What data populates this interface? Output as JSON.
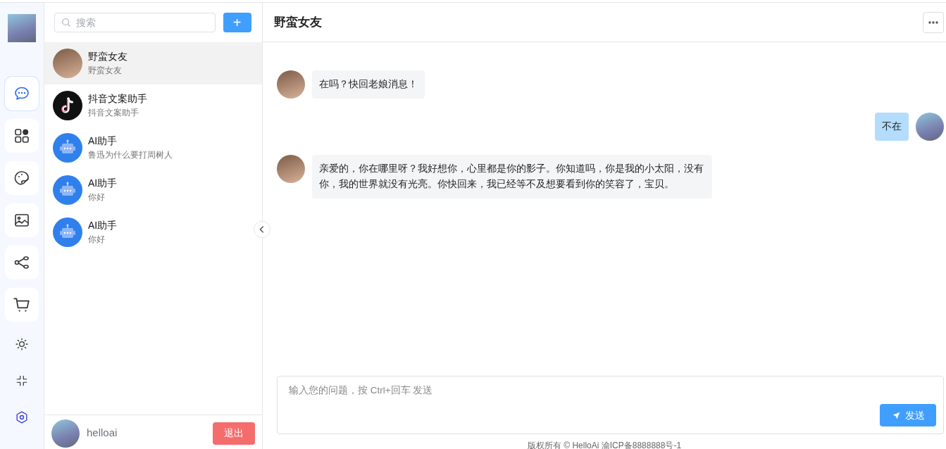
{
  "rail": {
    "items": [
      {
        "kind": "chat",
        "selected": true
      },
      {
        "kind": "apps",
        "selected": false
      },
      {
        "kind": "palette",
        "selected": false
      },
      {
        "kind": "image",
        "selected": false
      },
      {
        "kind": "share",
        "selected": false
      },
      {
        "kind": "cart",
        "selected": false
      }
    ],
    "tools": [
      {
        "kind": "sun"
      },
      {
        "kind": "shrink"
      },
      {
        "kind": "settings"
      }
    ]
  },
  "conversations": {
    "search": {
      "placeholder": "搜索"
    },
    "add_button": "+",
    "items": [
      {
        "name": "野蛮女友",
        "preview": "野蛮女友",
        "kind": "photo",
        "selected": true
      },
      {
        "name": "抖音文案助手",
        "preview": "抖音文案助手",
        "kind": "tiktok",
        "selected": false
      },
      {
        "name": "AI助手",
        "preview": "鲁迅为什么要打周树人",
        "kind": "robot",
        "selected": false
      },
      {
        "name": "AI助手",
        "preview": "你好",
        "kind": "robot",
        "selected": false
      },
      {
        "name": "AI助手",
        "preview": "你好",
        "kind": "robot",
        "selected": false
      }
    ]
  },
  "user": {
    "name": "helloai",
    "logout": "退出"
  },
  "chat": {
    "title": "野蛮女友",
    "messages": [
      {
        "kind": "bot",
        "text": "在吗？快回老娘消息！"
      },
      {
        "kind": "me",
        "text": "不在"
      },
      {
        "kind": "bot",
        "text": "亲爱的，你在哪里呀？我好想你，心里都是你的影子。你知道吗，你是我的小太阳，没有你，我的世界就没有光亮。你快回来，我已经等不及想要看到你的笑容了，宝贝。"
      }
    ],
    "input": {
      "placeholder": "输入您的问题，按 Ctrl+回车 发送"
    },
    "send": "发送"
  },
  "footer": "版权所有 © HelloAi 渝ICP备8888888号-1"
}
